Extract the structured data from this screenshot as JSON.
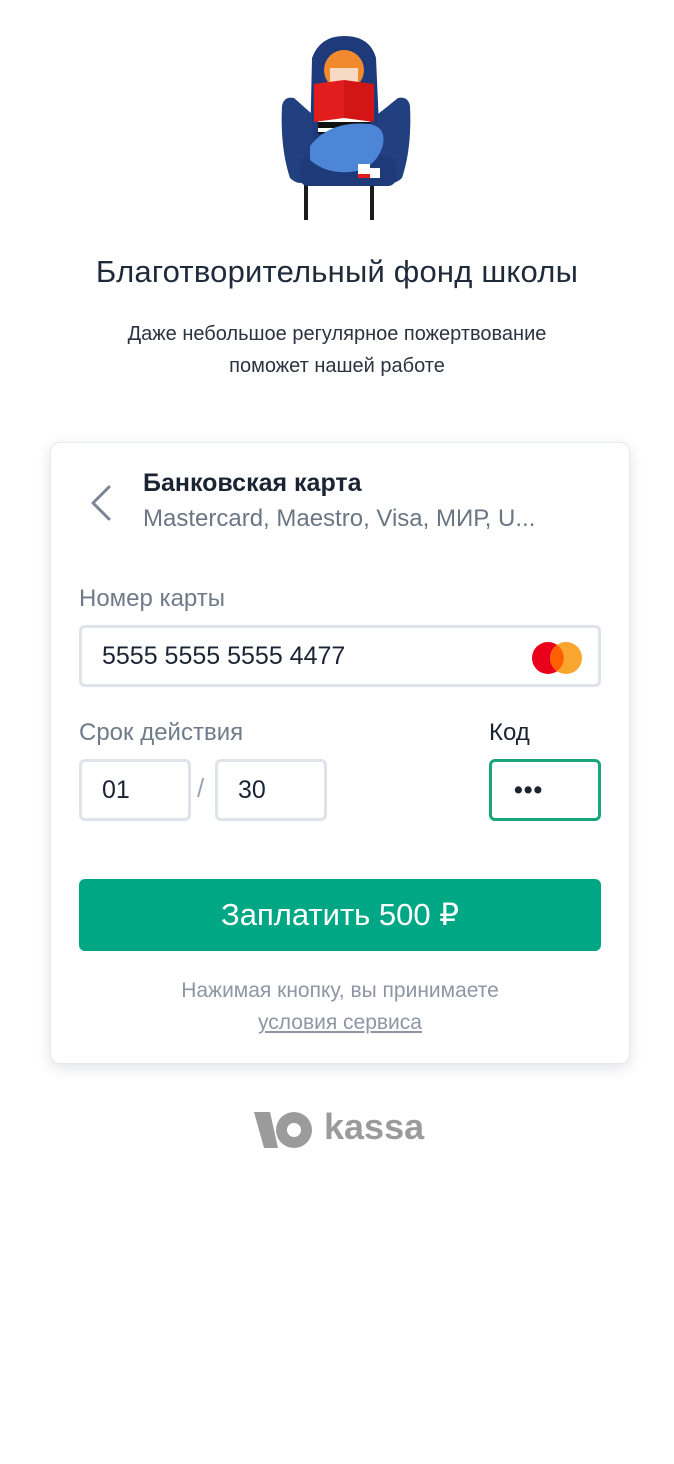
{
  "header": {
    "illustration": "child-reading-in-armchair-illustration",
    "title": "Благотворительный фонд школы",
    "subtitle_line1": "Даже небольшое регулярное пожертвование",
    "subtitle_line2": "поможет нашей работе"
  },
  "payment_method": {
    "back_icon": "chevron-left-icon",
    "title": "Банковская карта",
    "subtitle": "Mastercard, Maestro, Visa, МИР, U..."
  },
  "form": {
    "card_number_label": "Номер карты",
    "card_number_value": "5555 5555 5555 4477",
    "card_brand_icon": "mastercard-icon",
    "expiry_label": "Срок действия",
    "expiry_month": "01",
    "expiry_separator": "/",
    "expiry_year": "30",
    "code_label": "Код",
    "code_value": "•••"
  },
  "pay_button": {
    "label": "Заплатить 500 ₽",
    "color": "#00a784"
  },
  "terms": {
    "text": "Нажимая кнопку, вы принимаете",
    "link": "условия сервиса"
  },
  "footer": {
    "logo_text": "kassa",
    "logo_icon": "yoomoney-logo-icon"
  }
}
